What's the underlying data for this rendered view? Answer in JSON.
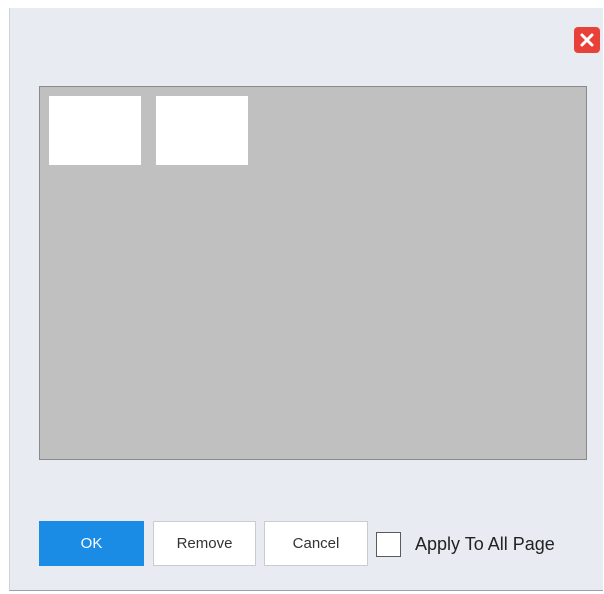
{
  "dialog": {
    "close_icon": "close-icon",
    "close_color": "#e8413a"
  },
  "preview": {
    "thumbnails": [
      {
        "name": "thumbnail-1"
      },
      {
        "name": "thumbnail-2"
      }
    ]
  },
  "buttons": {
    "ok_label": "OK",
    "remove_label": "Remove",
    "cancel_label": "Cancel",
    "ok_color": "#1a8ce6"
  },
  "apply_all": {
    "label": "Apply To All Page",
    "checked": false
  }
}
